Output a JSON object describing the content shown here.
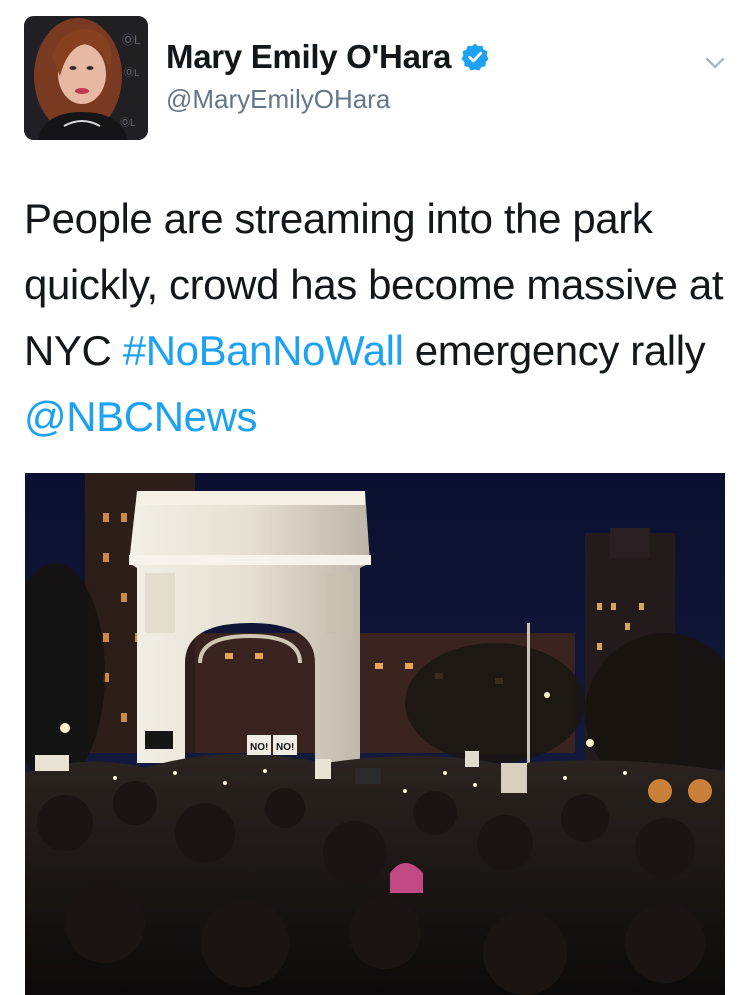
{
  "author": {
    "display_name": "Mary Emily O'Hara",
    "handle": "@MaryEmilyOHara",
    "verified": true,
    "verified_icon": "verified-badge-icon",
    "avatar_icon": "avatar"
  },
  "tweet": {
    "text_part1": "People are streaming into the park quickly, crowd has become massive at NYC ",
    "hashtag": "#NoBanNoWall",
    "text_part2": " emergency rally ",
    "mention": "@NBCNews"
  },
  "photo": {
    "sign_left": "NO!",
    "sign_right": "NO!"
  },
  "colors": {
    "link": "#1da1f2",
    "verified": "#1da1f2",
    "text": "#14171a",
    "secondary": "#657786"
  },
  "menu": {
    "caret_icon": "chevron-down-icon"
  }
}
